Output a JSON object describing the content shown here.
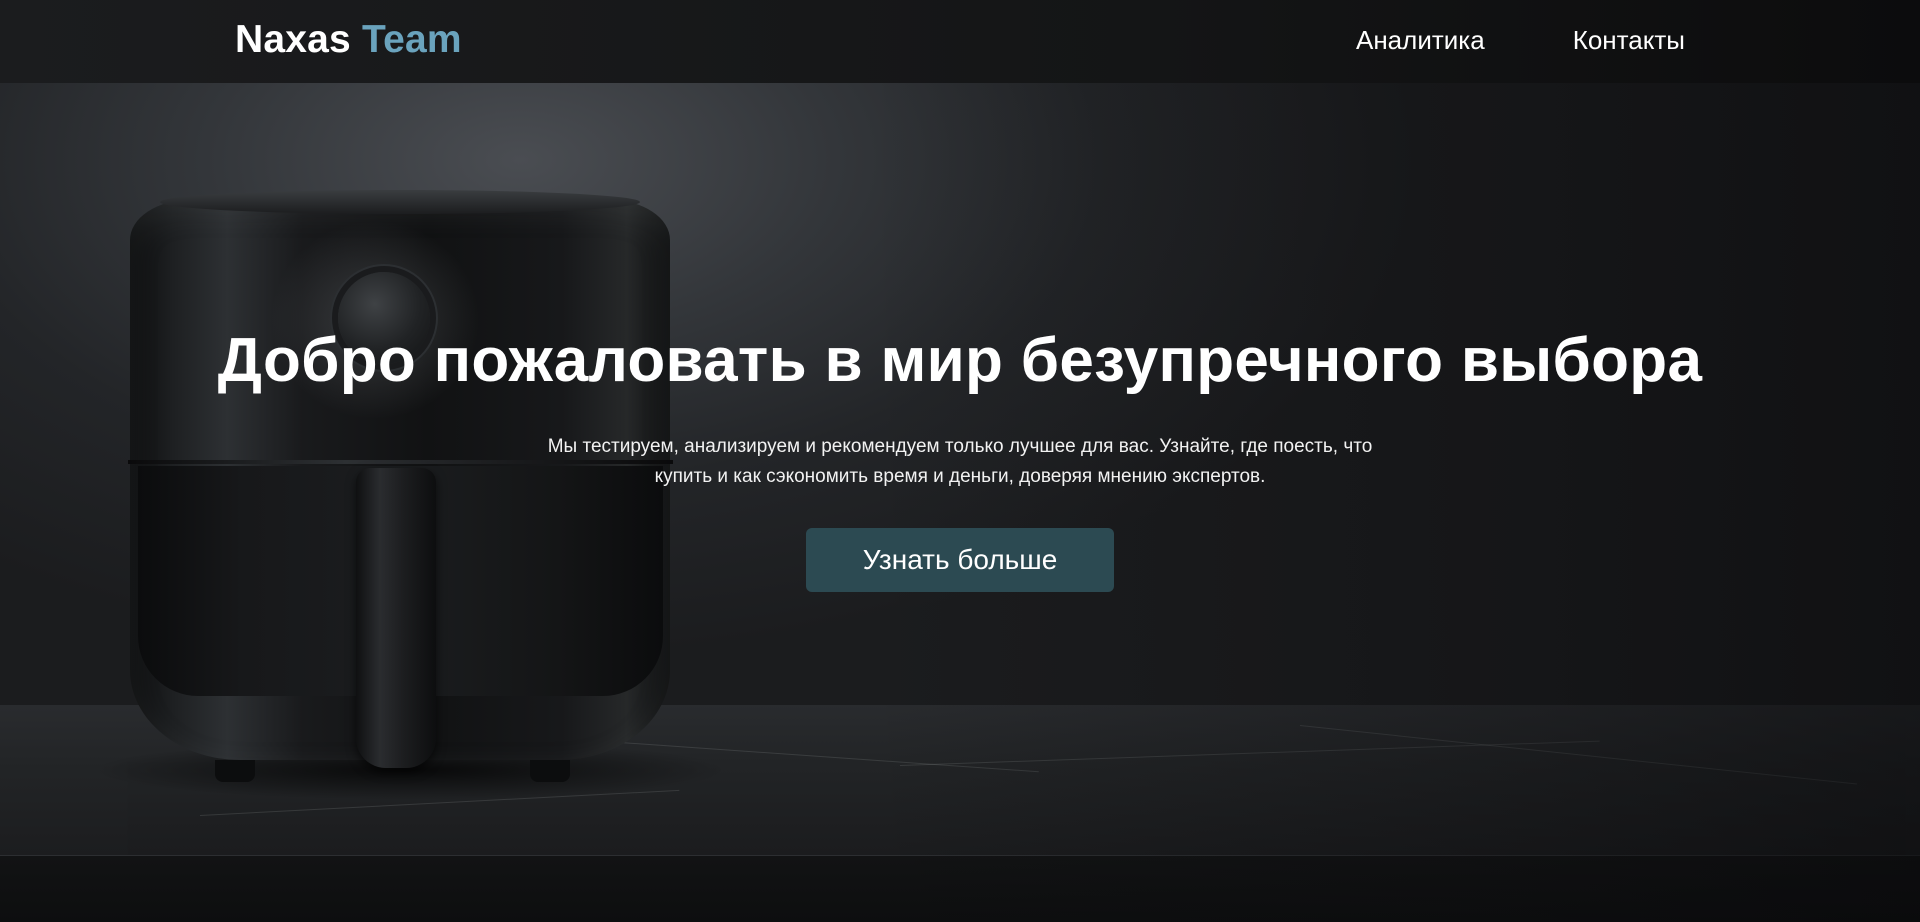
{
  "header": {
    "logo_primary": "Naxas",
    "logo_accent": "Team",
    "nav": [
      {
        "label": "Аналитика"
      },
      {
        "label": "Контакты"
      }
    ]
  },
  "hero": {
    "title": "Добро пожаловать в мир безупречного выбора",
    "subtitle": "Мы тестируем, анализируем и рекомендуем только лучшее для вас. Узнайте, где поесть, что купить и как сэкономить время и деньги, доверяя мнению экспертов.",
    "cta_label": "Узнать больше"
  },
  "colors": {
    "logo_accent": "#6aa3bd",
    "cta_background": "#2c4a52",
    "header_background": "#141516"
  }
}
